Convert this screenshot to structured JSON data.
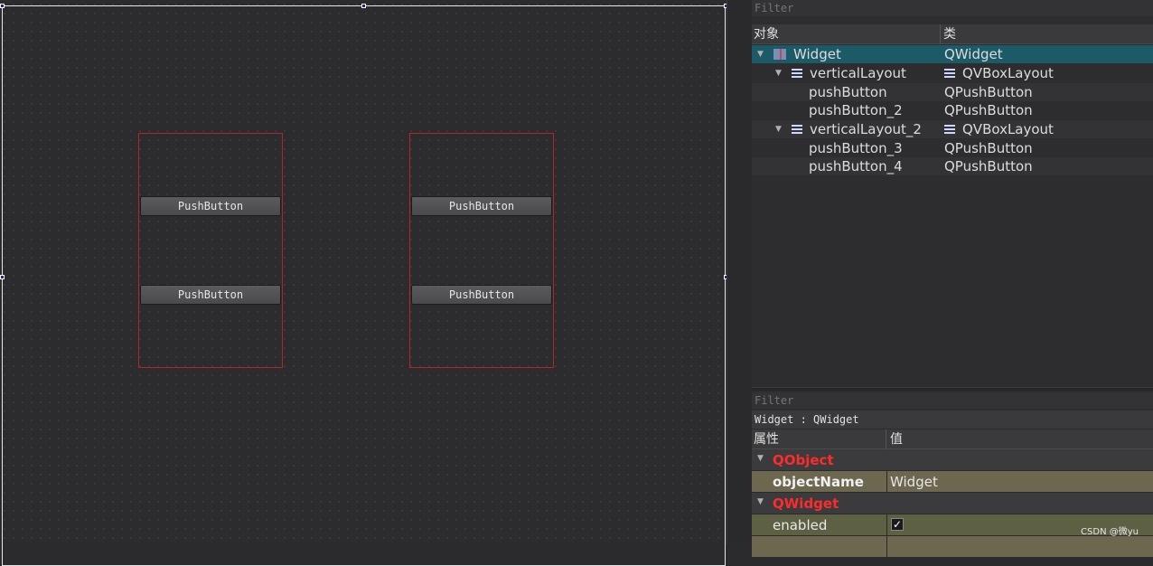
{
  "canvas": {
    "buttons": [
      "PushButton",
      "PushButton",
      "PushButton",
      "PushButton"
    ]
  },
  "object_inspector": {
    "filter_placeholder": "Filter",
    "headers": {
      "object": "对象",
      "class": "类"
    },
    "rows": [
      {
        "name": "Widget",
        "class": "QWidget",
        "icon": "widget-icon"
      },
      {
        "name": "verticalLayout",
        "class": "QVBoxLayout",
        "icon": "layout-icon"
      },
      {
        "name": "pushButton",
        "class": "QPushButton"
      },
      {
        "name": "pushButton_2",
        "class": "QPushButton"
      },
      {
        "name": "verticalLayout_2",
        "class": "QVBoxLayout",
        "icon": "layout-icon"
      },
      {
        "name": "pushButton_3",
        "class": "QPushButton"
      },
      {
        "name": "pushButton_4",
        "class": "QPushButton"
      }
    ]
  },
  "property_editor": {
    "filter_placeholder": "Filter",
    "object_title": "Widget : QWidget",
    "headers": {
      "property": "属性",
      "value": "值"
    },
    "groups": [
      {
        "name": "QObject"
      },
      {
        "name": "QWidget"
      }
    ],
    "properties": [
      {
        "name": "objectName",
        "value": "Widget"
      },
      {
        "name": "enabled",
        "value": "✓"
      }
    ]
  },
  "watermark": "CSDN @微yu",
  "colors": {
    "selection": "#1d5a68",
    "layout_border": "#b3252b",
    "group_text": "#ff2b2b"
  }
}
